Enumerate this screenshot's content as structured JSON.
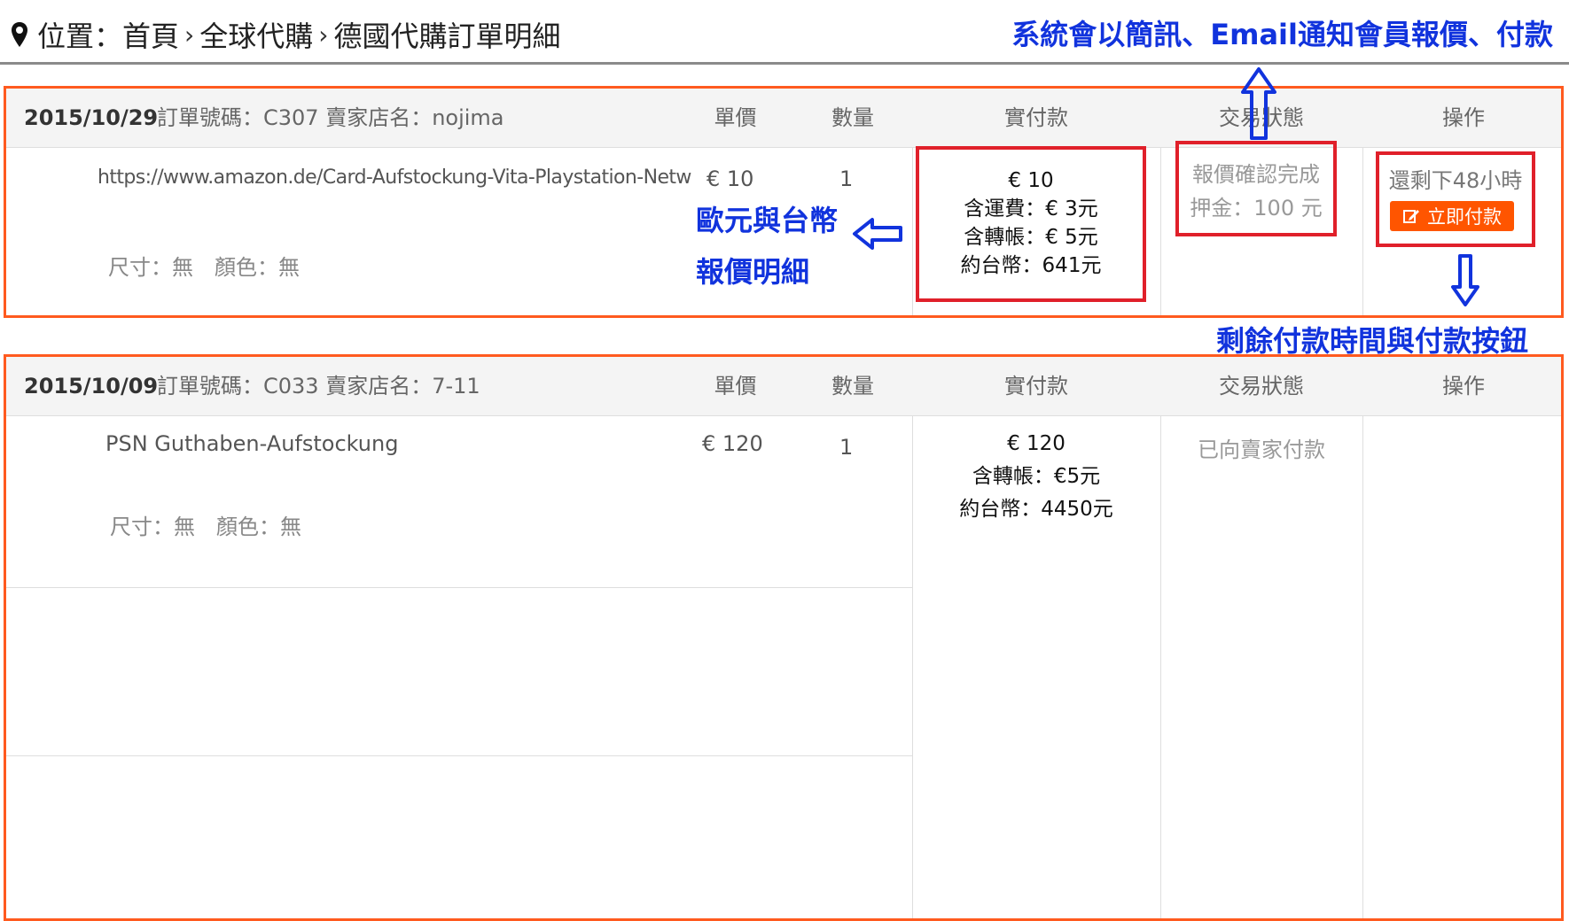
{
  "breadcrumb": {
    "prefix": "位置：",
    "items": [
      "首頁",
      "全球代購",
      "德國代購訂單明細"
    ]
  },
  "notice": "系統會以簡訊、Email通知會員報價、付款",
  "columns": {
    "unit_price": "單價",
    "quantity": "數量",
    "paid": "實付款",
    "status": "交易狀態",
    "action": "操作"
  },
  "orders": [
    {
      "date": "2015/10/29",
      "meta": "訂單號碼：C307 賣家店名：nojima",
      "product": "https://www.amazon.de/Card-Aufstockung-Vita-Playstation-Netw",
      "spec": "尺寸：無　顏色：無",
      "unit_price": "€ 10",
      "quantity": "1",
      "payment": [
        "€ 10",
        "含運費：€ 3元",
        "含轉帳：€ 5元",
        "約台幣：641元"
      ],
      "status": [
        "報價確認完成",
        "押金：100 元"
      ],
      "action": {
        "time_left": "還剩下48小時",
        "button": "立即付款"
      }
    },
    {
      "date": "2015/10/09",
      "meta": "訂單號碼：C033 賣家店名：7-11",
      "product": "PSN Guthaben-Aufstockung",
      "spec": "尺寸：無　顏色：無",
      "unit_price": "€ 120",
      "quantity": "1",
      "payment": [
        "€ 120",
        "含轉帳：€5元",
        "約台幣：4450元"
      ],
      "status": [
        "已向賣家付款"
      ]
    }
  ],
  "annotations": {
    "price_detail_1": "歐元與台幣",
    "price_detail_2": "報價明細",
    "pay_time": "剩餘付款時間與付款按鈕"
  },
  "colors": {
    "accent": "#ff5a1f",
    "highlight": "#e0202a",
    "annotation": "#1133dd",
    "button": "#ff5500"
  }
}
